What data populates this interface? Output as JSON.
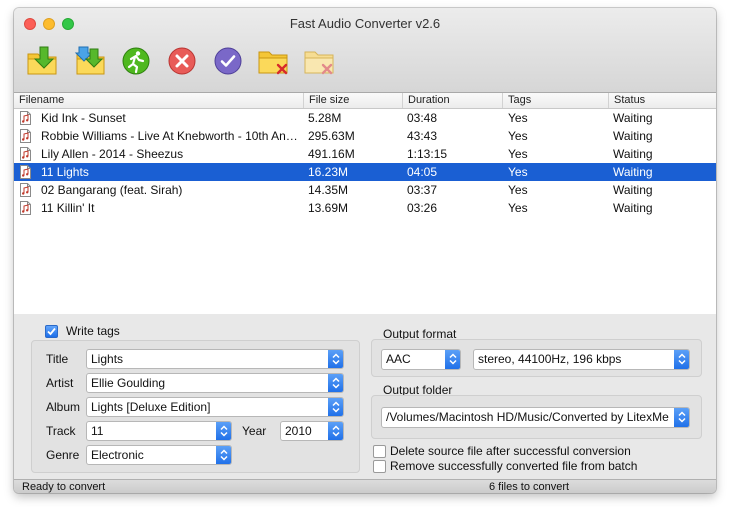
{
  "window": {
    "title": "Fast Audio Converter v2.6"
  },
  "toolbar": [
    {
      "name": "add-files-button",
      "icon": "folder-add-icon"
    },
    {
      "name": "add-folder-button",
      "icon": "folder-add-multiple-icon"
    },
    {
      "name": "start-convert-button",
      "icon": "running-man-icon"
    },
    {
      "name": "stop-button",
      "icon": "stop-x-icon"
    },
    {
      "name": "check-button",
      "icon": "checkmark-icon"
    },
    {
      "name": "remove-file-button",
      "icon": "folder-remove-icon"
    },
    {
      "name": "clear-list-button",
      "icon": "folder-clear-icon"
    }
  ],
  "table": {
    "columns": [
      "Filename",
      "File size",
      "Duration",
      "Tags",
      "Status"
    ],
    "rows": [
      {
        "filename": "Kid Ink - Sunset",
        "size": "5.28M",
        "duration": "03:48",
        "tags": "Yes",
        "status": "Waiting",
        "selected": false
      },
      {
        "filename": "Robbie Williams - Live At Knebworth - 10th An…",
        "size": "295.63M",
        "duration": "43:43",
        "tags": "Yes",
        "status": "Waiting",
        "selected": false
      },
      {
        "filename": "Lily Allen - 2014 - Sheezus",
        "size": "491.16M",
        "duration": "1:13:15",
        "tags": "Yes",
        "status": "Waiting",
        "selected": false
      },
      {
        "filename": "11 Lights",
        "size": "16.23M",
        "duration": "04:05",
        "tags": "Yes",
        "status": "Waiting",
        "selected": true
      },
      {
        "filename": "02 Bangarang (feat. Sirah)",
        "size": "14.35M",
        "duration": "03:37",
        "tags": "Yes",
        "status": "Waiting",
        "selected": false
      },
      {
        "filename": "11 Killin' It",
        "size": "13.69M",
        "duration": "03:26",
        "tags": "Yes",
        "status": "Waiting",
        "selected": false
      }
    ]
  },
  "tags": {
    "write_tags_label": "Write tags",
    "write_tags_checked": true,
    "title_label": "Title",
    "title_value": "Lights",
    "artist_label": "Artist",
    "artist_value": "Ellie Goulding",
    "album_label": "Album",
    "album_value": "Lights [Deluxe Edition]",
    "track_label": "Track",
    "track_value": "11",
    "year_label": "Year",
    "year_value": "2010",
    "genre_label": "Genre",
    "genre_value": "Electronic"
  },
  "output": {
    "format_label": "Output format",
    "format_value": "AAC",
    "quality_value": "stereo, 44100Hz, 196 kbps",
    "folder_label": "Output folder",
    "folder_value": "/Volumes/Macintosh HD/Music/Converted by LitexMe",
    "delete_source_label": "Delete source file after successful conversion",
    "delete_source_checked": false,
    "remove_converted_label": "Remove successfully converted file from batch",
    "remove_converted_checked": false
  },
  "status": {
    "left": "Ready to convert",
    "center": "6 files to convert"
  },
  "colors": {
    "selection": "#1a5fd3",
    "accent": "#1d6ee8"
  }
}
